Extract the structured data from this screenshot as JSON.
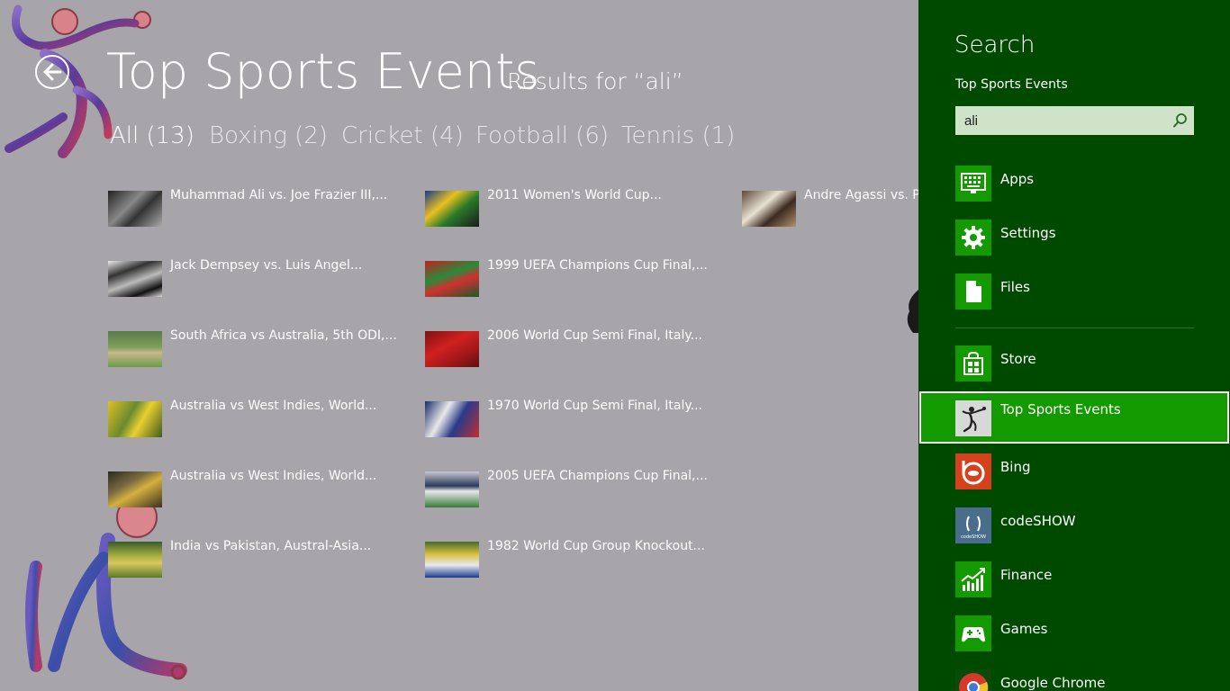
{
  "app": {
    "title": "Top Sports Events",
    "subtitle": "Results for “ali”",
    "back_icon": "back-arrow-icon",
    "filters": [
      {
        "label": "All (13)",
        "active": true
      },
      {
        "label": "Boxing (2)",
        "active": false
      },
      {
        "label": "Cricket (4)",
        "active": false
      },
      {
        "label": "Football (6)",
        "active": false
      },
      {
        "label": "Tennis (1)",
        "active": false
      }
    ],
    "results": [
      {
        "label": "Muhammad Ali vs. Joe Frazier III,...",
        "thumb": "boxing-bw"
      },
      {
        "label": "Jack Dempsey vs. Luis Angel...",
        "thumb": "boxing-bw2"
      },
      {
        "label": "South Africa vs Australia, 5th ODI,...",
        "thumb": "cricket-field"
      },
      {
        "label": "Australia vs West Indies, World...",
        "thumb": "cricket-yellow"
      },
      {
        "label": "Australia vs West Indies, World...",
        "thumb": "cricket-crowd"
      },
      {
        "label": "India vs Pakistan, Austral-Asia...",
        "thumb": "cricket-ground"
      },
      {
        "label": "2011 Women's World Cup...",
        "thumb": "football-women"
      },
      {
        "label": "1999 UEFA Champions Cup Final,...",
        "thumb": "football-red"
      },
      {
        "label": "2006 World Cup Semi Final, Italy...",
        "thumb": "football-redcrowd"
      },
      {
        "label": "1970 World Cup Semi Final, Italy...",
        "thumb": "football-blue"
      },
      {
        "label": "2005 UEFA Champions Cup Final,...",
        "thumb": "football-team"
      },
      {
        "label": "1982 World Cup Group Knockout...",
        "thumb": "football-eco"
      },
      {
        "label": "Andre Agassi vs. Pete",
        "thumb": "tennis-crowd"
      }
    ]
  },
  "charm": {
    "title": "Search",
    "scope": "Top Sports Events",
    "query": "ali",
    "search_icon": "magnifier-icon",
    "items": [
      {
        "label": "Apps",
        "icon": "keyboard-icon",
        "tile_color": "#139a00"
      },
      {
        "label": "Settings",
        "icon": "gear-icon",
        "tile_color": "#139a00"
      },
      {
        "label": "Files",
        "icon": "document-icon",
        "tile_color": "#139a00"
      },
      {
        "label": "Store",
        "icon": "store-bag-icon",
        "tile_color": "#139a00"
      },
      {
        "label": "Top Sports Events",
        "icon": "sports-app-icon",
        "tile_color": "#d8d8d8",
        "selected": true
      },
      {
        "label": "Bing",
        "icon": "bing-icon",
        "tile_color": "#d6401d"
      },
      {
        "label": "codeSHOW",
        "icon": "codeshow-icon",
        "tile_color": "#4a6d8c"
      },
      {
        "label": "Finance",
        "icon": "finance-chart-icon",
        "tile_color": "#139a00"
      },
      {
        "label": "Games",
        "icon": "gamepad-icon",
        "tile_color": "#139a00"
      },
      {
        "label": "Google Chrome",
        "icon": "chrome-icon",
        "tile_color": "#0a4a0a"
      }
    ],
    "codeshow_caption": "codeSHOW",
    "accent": "#004a00",
    "selected_color": "#139a00"
  }
}
